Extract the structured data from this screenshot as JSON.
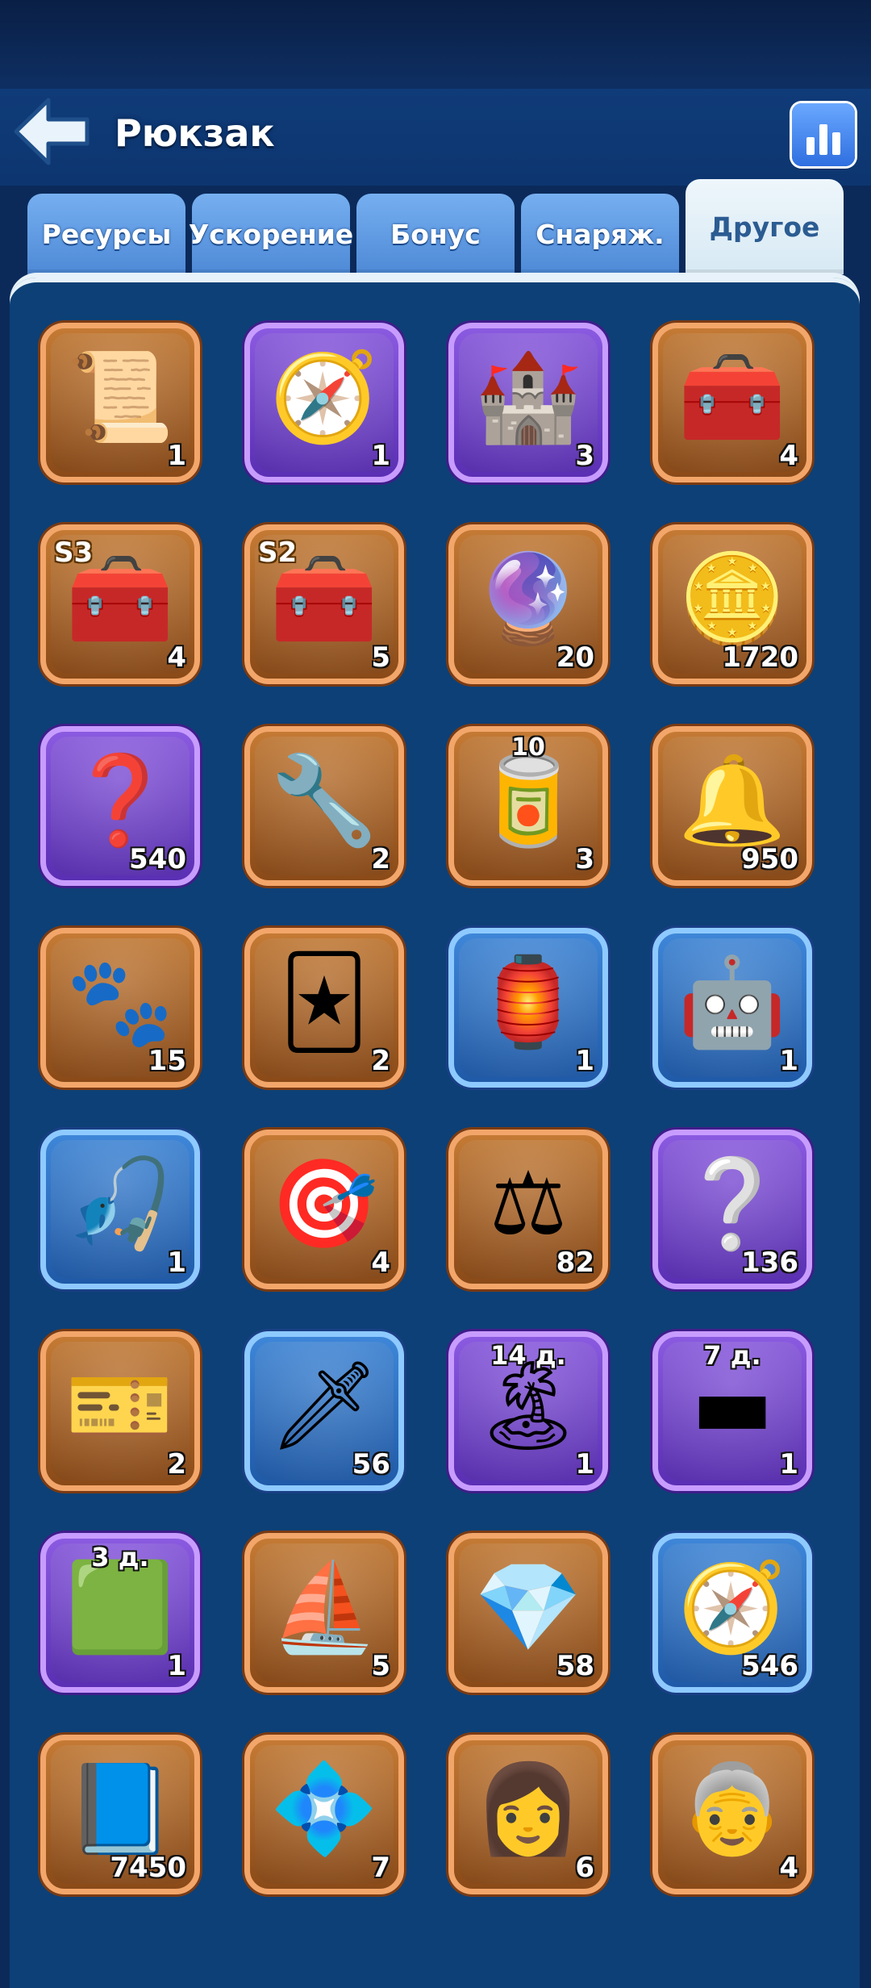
{
  "header": {
    "title": "Рюкзак"
  },
  "tabs": [
    {
      "label": "Ресурсы"
    },
    {
      "label": "Ускорение"
    },
    {
      "label": "Бонус"
    },
    {
      "label": "Снаряж."
    },
    {
      "label": "Другое",
      "active": true
    }
  ],
  "items": [
    {
      "icon": "scroll-icon",
      "glyph": "📜",
      "count": "1",
      "rarity": "orange"
    },
    {
      "icon": "compass-boost-icon",
      "glyph": "🧭",
      "count": "1",
      "rarity": "purple"
    },
    {
      "icon": "building-relocate-icon",
      "glyph": "🏰",
      "count": "3",
      "rarity": "purple"
    },
    {
      "icon": "treasure-chest-icon",
      "glyph": "🧰",
      "count": "4",
      "rarity": "orange"
    },
    {
      "icon": "season-chest-icon",
      "glyph": "🧰",
      "count": "4",
      "rarity": "orange",
      "season": "S3"
    },
    {
      "icon": "season-chest-icon",
      "glyph": "🧰",
      "count": "5",
      "rarity": "orange",
      "season": "S2"
    },
    {
      "icon": "rune-token-icon",
      "glyph": "🔮",
      "count": "20",
      "rarity": "orange"
    },
    {
      "icon": "gold-coin-icon",
      "glyph": "🪙",
      "count": "1720",
      "rarity": "orange"
    },
    {
      "icon": "mystery-badge-icon",
      "glyph": "❓",
      "count": "540",
      "rarity": "purple"
    },
    {
      "icon": "toolbox-icon",
      "glyph": "🔧",
      "count": "2",
      "rarity": "orange"
    },
    {
      "icon": "sardine-can-icon",
      "glyph": "🥫",
      "count": "3",
      "rarity": "orange",
      "topcount": "10"
    },
    {
      "icon": "bell-icon",
      "glyph": "🔔",
      "count": "950",
      "rarity": "orange"
    },
    {
      "icon": "paw-cookie-icon",
      "glyph": "🐾",
      "count": "15",
      "rarity": "orange"
    },
    {
      "icon": "card-icon",
      "glyph": "🃏",
      "count": "2",
      "rarity": "orange"
    },
    {
      "icon": "lantern-icon",
      "glyph": "🏮",
      "count": "1",
      "rarity": "blue"
    },
    {
      "icon": "robot-drone-icon",
      "glyph": "🤖",
      "count": "1",
      "rarity": "blue"
    },
    {
      "icon": "fishing-reel-icon",
      "glyph": "🎣",
      "count": "1",
      "rarity": "blue"
    },
    {
      "icon": "target-ticket-icon",
      "glyph": "🎯",
      "count": "4",
      "rarity": "orange"
    },
    {
      "icon": "scales-ticket-icon",
      "glyph": "⚖",
      "count": "82",
      "rarity": "orange"
    },
    {
      "icon": "mystery-card-icon",
      "glyph": "❔",
      "count": "136",
      "rarity": "purple"
    },
    {
      "icon": "gold-ticket-icon",
      "glyph": "🎫",
      "count": "2",
      "rarity": "orange"
    },
    {
      "icon": "arrowhead-icon",
      "glyph": "🗡",
      "count": "56",
      "rarity": "blue"
    },
    {
      "icon": "island-castle-icon",
      "glyph": "🏝",
      "count": "1",
      "rarity": "purple",
      "timer": "14 д."
    },
    {
      "icon": "nameplate-icon",
      "glyph": "▬",
      "count": "1",
      "rarity": "purple",
      "timer": "7 д."
    },
    {
      "icon": "frame-green-icon",
      "glyph": "🟩",
      "count": "1",
      "rarity": "purple",
      "timer": "3 д."
    },
    {
      "icon": "ship-trophy-icon",
      "glyph": "⛵",
      "count": "5",
      "rarity": "orange"
    },
    {
      "icon": "ruby-amulet-icon",
      "glyph": "💎",
      "count": "58",
      "rarity": "orange"
    },
    {
      "icon": "pocket-compass-icon",
      "glyph": "🧭",
      "count": "546",
      "rarity": "blue"
    },
    {
      "icon": "blue-book-icon",
      "glyph": "📘",
      "count": "7450",
      "rarity": "orange"
    },
    {
      "icon": "crystal-shard-icon",
      "glyph": "💠",
      "count": "7",
      "rarity": "orange"
    },
    {
      "icon": "hero-shard-icon",
      "glyph": "👩",
      "count": "6",
      "rarity": "orange"
    },
    {
      "icon": "hero-shard-icon",
      "glyph": "👵",
      "count": "4",
      "rarity": "orange"
    }
  ]
}
